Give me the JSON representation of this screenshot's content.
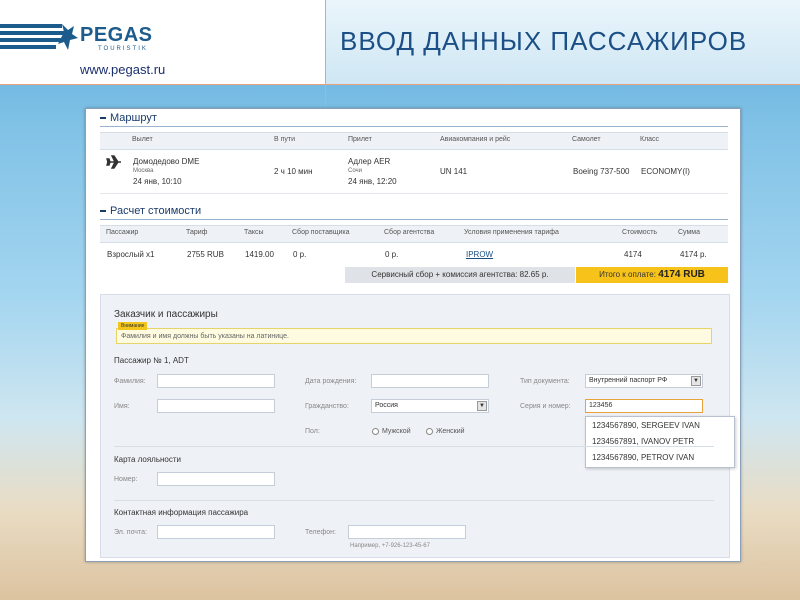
{
  "header": {
    "logo_text": "PEGAS",
    "logo_sub": "TOURISTIK",
    "site_url": "www.pegast.ru",
    "title": "ВВОД ДАННЫХ ПАССАЖИРОВ"
  },
  "route": {
    "section_title": "Маршрут",
    "columns": [
      "Вылет",
      "В пути",
      "Прилет",
      "Авиакомпания и рейс",
      "Самолет",
      "Класс"
    ],
    "row": {
      "departure_airport": "Домодедово DME",
      "departure_city": "Москва",
      "departure_time": "24 янв, 10:10",
      "duration": "2 ч 10 мин",
      "arrival_airport": "Адлер AER",
      "arrival_city": "Сочи",
      "arrival_time": "24 янв, 12:20",
      "flight": "UN 141",
      "aircraft": "Boeing 737-500",
      "class": "ECONOMY(I)"
    }
  },
  "pricing": {
    "section_title": "Расчет стоимости",
    "columns": [
      "Пассажир",
      "Тариф",
      "Таксы",
      "Сбор поставщика",
      "Сбор агентства",
      "Условия применения тарифа",
      "Стоимость",
      "Сумма"
    ],
    "row": {
      "passenger": "Взрослый x1",
      "fare": "2755 RUB",
      "taxes": "1419.00",
      "supplier_fee": "0 р.",
      "agency_fee": "0 р.",
      "fare_rules": "IPROW",
      "cost": "4174",
      "total": "4174 р."
    },
    "service_fee_text": "Сервисный сбор + комиссия агентства: 82.65 р.",
    "total_label": "Итого к оплате:",
    "total_value": "4174 RUB"
  },
  "form": {
    "title": "Заказчик и пассажиры",
    "warning_tag": "Внимание",
    "warning_text": "Фамилия и имя должны быть указаны на латинице.",
    "passenger_title": "Пассажир № 1, ADT",
    "lastname_label": "Фамилия:",
    "firstname_label": "Имя:",
    "birthdate_label": "Дата рождения:",
    "citizenship_label": "Гражданство:",
    "citizenship_value": "Россия",
    "gender_label": "Пол:",
    "gender_male": "Мужской",
    "gender_female": "Женский",
    "doctype_label": "Тип документа:",
    "doctype_value": "Внутренний паспорт РФ",
    "docnum_label": "Серия и номер:",
    "docnum_value": "123456",
    "suggestions": [
      "1234567890, SERGEEV IVAN",
      "1234567891, IVANOV PETR",
      "1234567890, PETROV IVAN"
    ],
    "loyalty_title": "Карта лояльности",
    "loyalty_number_label": "Номер:",
    "contact_title": "Контактная информация пассажира",
    "email_label": "Эл. почта:",
    "phone_label": "Телефон:",
    "phone_hint": "Например, +7-926-123-45-67"
  }
}
